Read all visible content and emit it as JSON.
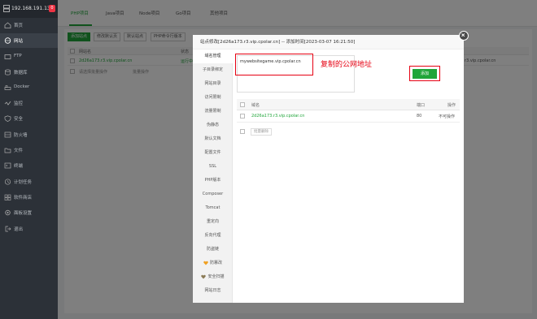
{
  "server": {
    "ip": "192.168.191.130",
    "badge": "0"
  },
  "sidebar": {
    "items": [
      {
        "label": "首页"
      },
      {
        "label": "网站"
      },
      {
        "label": "FTP"
      },
      {
        "label": "数据库"
      },
      {
        "label": "Docker"
      },
      {
        "label": "监控"
      },
      {
        "label": "安全"
      },
      {
        "label": "防火墙"
      },
      {
        "label": "文件"
      },
      {
        "label": "终端"
      },
      {
        "label": "计划任务"
      },
      {
        "label": "软件商店"
      },
      {
        "label": "面板设置"
      },
      {
        "label": "退出"
      }
    ]
  },
  "topbar": {
    "tabs": [
      {
        "label": "PHP项目"
      },
      {
        "label": "Java项目"
      },
      {
        "label": "Node项目"
      },
      {
        "label": "Go项目"
      },
      {
        "label": "其他项目"
      }
    ]
  },
  "toolbar": {
    "add_site": "添加站点",
    "default_page": "修改默认页",
    "default_site": "默认站点",
    "php_cli": "PHP命令行版本"
  },
  "site_list": {
    "col_name": "网站名",
    "col_status": "状态",
    "row_domain": "2d26a173.r3.vip.cpolar.cn",
    "row_status": "运行中",
    "row_right": "r3.vip.cpolar.cn",
    "batch_select": "请选择批量操作",
    "batch_btn": "批量操作"
  },
  "modal": {
    "title": "站点修改[2d26a173.r3.vip.cpolar.cn] -- 添加时间[2023-03-07 16:21:50]",
    "menu": [
      {
        "label": "域名管理"
      },
      {
        "label": "子目录绑定"
      },
      {
        "label": "网站目录"
      },
      {
        "label": "访问限制"
      },
      {
        "label": "流量限制"
      },
      {
        "label": "伪静态"
      },
      {
        "label": "默认文档"
      },
      {
        "label": "配置文件"
      },
      {
        "label": "SSL"
      },
      {
        "label": "PHP版本"
      },
      {
        "label": "Composer"
      },
      {
        "label": "Tomcat"
      },
      {
        "label": "重定向"
      },
      {
        "label": "反向代理"
      },
      {
        "label": "防盗链"
      },
      {
        "label": "防篡改"
      },
      {
        "label": "安全扫描"
      },
      {
        "label": "网站日志"
      }
    ],
    "textarea_value": "mywebsitegame.vip.cpolar.cn",
    "annotation": "复制的公网地址",
    "add_btn": "添加",
    "table": {
      "col_domain": "域名",
      "col_port": "端口",
      "col_action": "操作",
      "rows": [
        {
          "domain": "2d26a173.r3.vip.cpolar.cn",
          "port": "80",
          "action": "不可操作"
        }
      ],
      "batch_delete": "批量删除"
    }
  },
  "colors": {
    "accent": "#20a53a",
    "annotation": "#e60012",
    "sidebar": "#2c3138"
  }
}
